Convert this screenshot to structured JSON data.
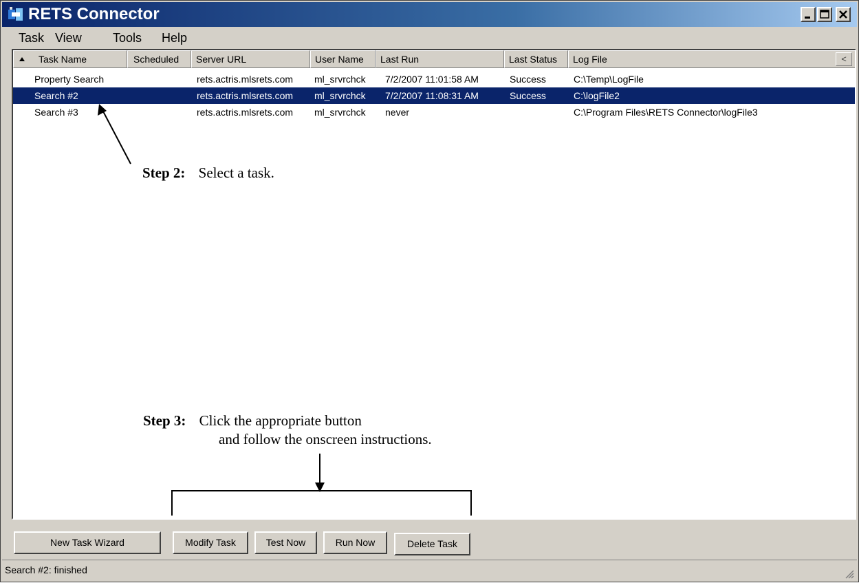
{
  "window": {
    "title": "RETS Connector",
    "icon": "rets-connector-app-icon",
    "controls": [
      "minimize-icon",
      "maximize-icon",
      "close-icon"
    ]
  },
  "menu": [
    "Task",
    "View",
    "Tools",
    "Help"
  ],
  "list": {
    "columns": [
      "Task Name",
      "Scheduled",
      "Server URL",
      "User Name",
      "Last Run",
      "Last Status",
      "Log File"
    ],
    "sort_column": "Task Name",
    "rows": [
      {
        "task_name": "Property Search",
        "scheduled": "",
        "server_url": "rets.actris.mlsrets.com",
        "user_name": "ml_srvrchck",
        "last_run": "7/2/2007 11:01:58 AM",
        "last_status": "Success",
        "log_file": "C:\\Temp\\LogFile"
      },
      {
        "task_name": "Search #2",
        "scheduled": "",
        "server_url": "rets.actris.mlsrets.com",
        "user_name": "ml_srvrchck",
        "last_run": "7/2/2007 11:08:31 AM",
        "last_status": "Success",
        "log_file": "C:\\logFile2"
      },
      {
        "task_name": "Search #3",
        "scheduled": "",
        "server_url": "rets.actris.mlsrets.com",
        "user_name": "ml_srvrchck",
        "last_run": "never",
        "last_status": "",
        "log_file": "C:\\Program Files\\RETS Connector\\logFile3"
      }
    ],
    "selected_row": "Search #2",
    "scroll_button": "<"
  },
  "annotations": {
    "step2_label": "Step 2:",
    "step2_text": "Select a task.",
    "step3_label": "Step 3:",
    "step3_line1": "Click the appropriate button",
    "step3_line2": "and follow the onscreen instructions."
  },
  "buttons": {
    "new_task_wizard": "New Task Wizard",
    "modify_task": "Modify Task",
    "test_now": "Test Now",
    "run_now": "Run Now",
    "delete_task": "Delete Task"
  },
  "status_bar": {
    "text": "Search #2: finished"
  },
  "colors": {
    "selection": "#0a246a",
    "window_face": "#d4d0c8",
    "title_start": "#0a246a",
    "title_end": "#a6caf0"
  }
}
